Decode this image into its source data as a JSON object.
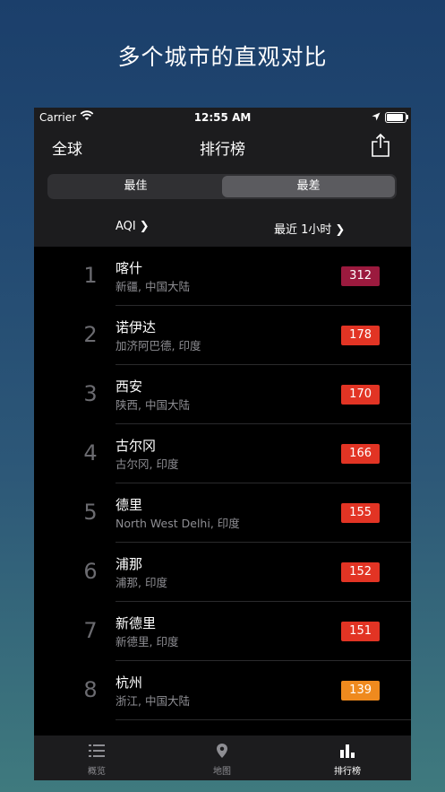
{
  "headline": "多个城市的直观对比",
  "status_bar": {
    "carrier": "Carrier",
    "time": "12:55 AM"
  },
  "navbar": {
    "left": "全球",
    "title": "排行榜",
    "share_icon": "share-icon"
  },
  "segment": {
    "options": [
      "最佳",
      "最差"
    ],
    "selected": "最差"
  },
  "filters": {
    "metric": "AQI",
    "time_range": "最近 1小时"
  },
  "rows": [
    {
      "rank": "1",
      "city": "喀什",
      "region": "新疆, 中国大陆",
      "aqi": "312",
      "color": "#9b1a3e"
    },
    {
      "rank": "2",
      "city": "诺伊达",
      "region": "加济阿巴德, 印度",
      "aqi": "178",
      "color": "#e23424"
    },
    {
      "rank": "3",
      "city": "西安",
      "region": "陕西, 中国大陆",
      "aqi": "170",
      "color": "#e23424"
    },
    {
      "rank": "4",
      "city": "古尔冈",
      "region": "古尔冈, 印度",
      "aqi": "166",
      "color": "#e23424"
    },
    {
      "rank": "5",
      "city": "德里",
      "region": "North West Delhi, 印度",
      "aqi": "155",
      "color": "#e23424"
    },
    {
      "rank": "6",
      "city": "浦那",
      "region": "浦那, 印度",
      "aqi": "152",
      "color": "#e23424"
    },
    {
      "rank": "7",
      "city": "新德里",
      "region": "新德里, 印度",
      "aqi": "151",
      "color": "#e23424"
    },
    {
      "rank": "8",
      "city": "杭州",
      "region": "浙江, 中国大陆",
      "aqi": "139",
      "color": "#ef8a1e"
    }
  ],
  "tabs": [
    {
      "label": "概览",
      "icon": "list-icon"
    },
    {
      "label": "地图",
      "icon": "location-pin-icon"
    },
    {
      "label": "排行榜",
      "icon": "bar-chart-icon"
    }
  ],
  "active_tab": "排行榜"
}
